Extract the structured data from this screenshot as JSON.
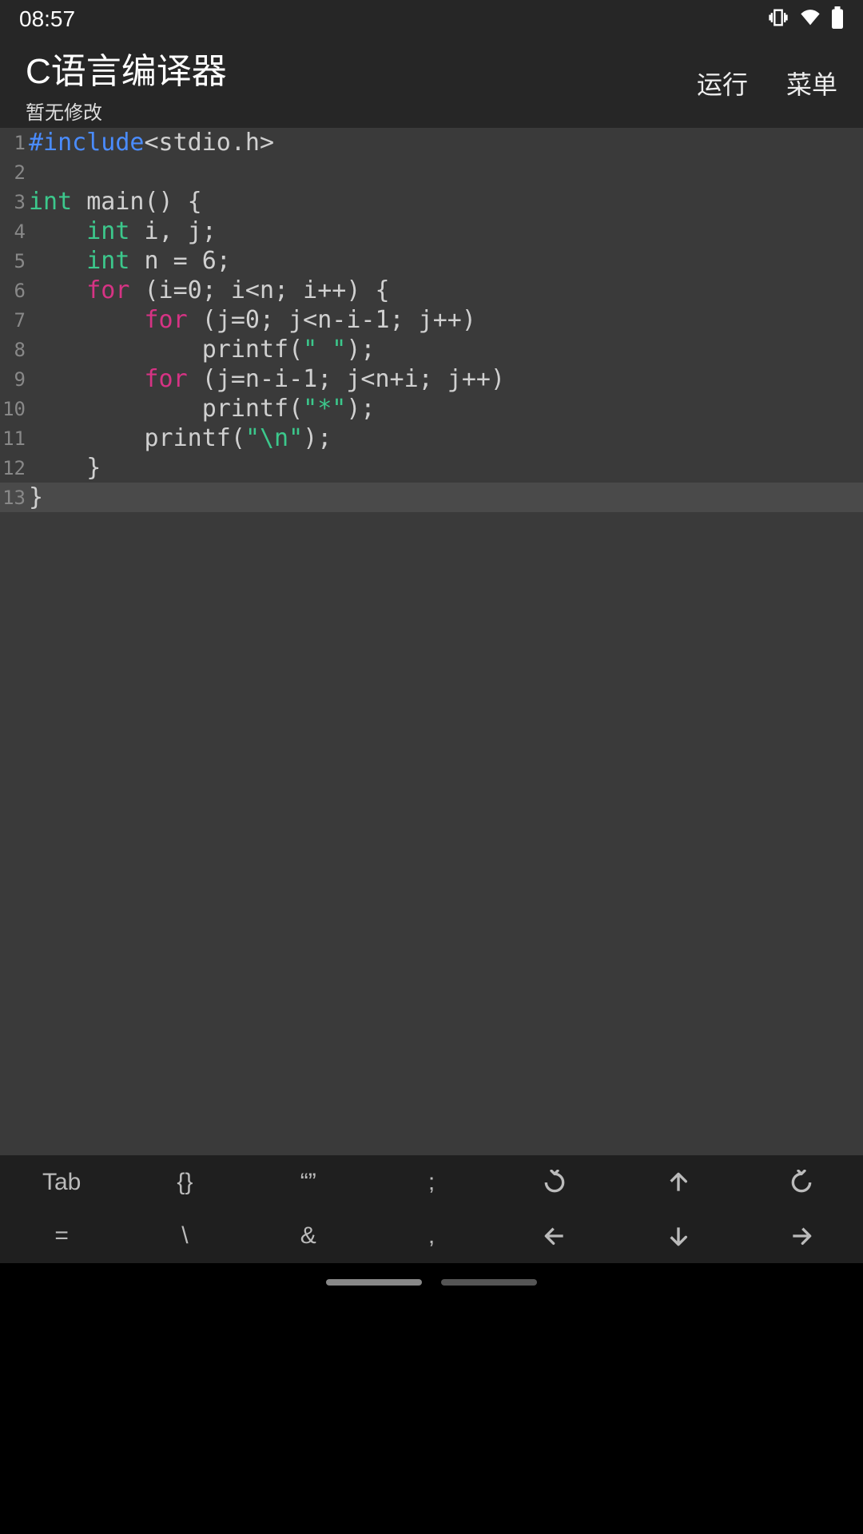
{
  "status": {
    "time": "08:57"
  },
  "header": {
    "title": "C语言编译器",
    "subtitle": "暂无修改",
    "run": "运行",
    "menu": "菜单"
  },
  "code": {
    "lines": [
      {
        "n": "1",
        "hl": false,
        "tokens": [
          [
            "preproc",
            "#include"
          ],
          [
            "plain",
            "<stdio.h>"
          ]
        ]
      },
      {
        "n": "2",
        "hl": false,
        "tokens": []
      },
      {
        "n": "3",
        "hl": false,
        "tokens": [
          [
            "type",
            "int"
          ],
          [
            "plain",
            " main() {"
          ]
        ]
      },
      {
        "n": "4",
        "hl": false,
        "tokens": [
          [
            "plain",
            "    "
          ],
          [
            "type",
            "int"
          ],
          [
            "plain",
            " i, j;"
          ]
        ]
      },
      {
        "n": "5",
        "hl": false,
        "tokens": [
          [
            "plain",
            "    "
          ],
          [
            "type",
            "int"
          ],
          [
            "plain",
            " n = 6;"
          ]
        ]
      },
      {
        "n": "6",
        "hl": false,
        "tokens": [
          [
            "plain",
            "    "
          ],
          [
            "keyword",
            "for"
          ],
          [
            "plain",
            " (i=0; i<n; i++) {"
          ]
        ]
      },
      {
        "n": "7",
        "hl": false,
        "tokens": [
          [
            "plain",
            "        "
          ],
          [
            "keyword",
            "for"
          ],
          [
            "plain",
            " (j=0; j<n-i-1; j++)"
          ]
        ]
      },
      {
        "n": "8",
        "hl": false,
        "tokens": [
          [
            "plain",
            "            printf("
          ],
          [
            "string",
            "\" \""
          ],
          [
            "plain",
            ");"
          ]
        ]
      },
      {
        "n": "9",
        "hl": false,
        "tokens": [
          [
            "plain",
            "        "
          ],
          [
            "keyword",
            "for"
          ],
          [
            "plain",
            " (j=n-i-1; j<n+i; j++)"
          ]
        ]
      },
      {
        "n": "10",
        "hl": false,
        "tokens": [
          [
            "plain",
            "            printf("
          ],
          [
            "string",
            "\"*\""
          ],
          [
            "plain",
            ");"
          ]
        ]
      },
      {
        "n": "11",
        "hl": false,
        "tokens": [
          [
            "plain",
            "        printf("
          ],
          [
            "string",
            "\"\\n\""
          ],
          [
            "plain",
            ");"
          ]
        ]
      },
      {
        "n": "12",
        "hl": false,
        "tokens": [
          [
            "plain",
            "    }"
          ]
        ]
      },
      {
        "n": "13",
        "hl": true,
        "tokens": [
          [
            "plain",
            "}"
          ]
        ]
      }
    ]
  },
  "toolbar": {
    "row1": [
      "Tab",
      "{}",
      "“”",
      ";",
      "undo-icon",
      "arrow-up-icon",
      "redo-icon"
    ],
    "row2": [
      "=",
      "\\",
      "&",
      ",",
      "arrow-left-icon",
      "arrow-down-icon",
      "arrow-right-icon"
    ]
  }
}
